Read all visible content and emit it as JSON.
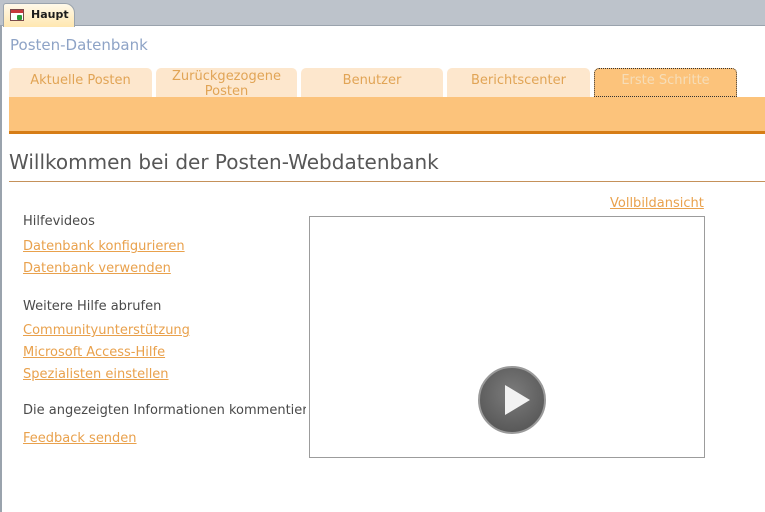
{
  "document_tab": {
    "label": "Haupt",
    "icon": "form-icon"
  },
  "database_title": "Posten-Datenbank",
  "nav_tabs": [
    {
      "label": "Aktuelle Posten"
    },
    {
      "label": "Zurückgezogene Posten"
    },
    {
      "label": "Benutzer"
    },
    {
      "label": "Berichtscenter"
    },
    {
      "label": "Erste Schritte",
      "active": true
    }
  ],
  "main": {
    "heading": "Willkommen bei der Posten-Webdatenbank",
    "fullscreen_link": "Vollbildansicht"
  },
  "help": {
    "videos_label": "Hilfevideos",
    "video_links": [
      "Datenbank konfigurieren",
      "Datenbank verwenden"
    ],
    "more_help_label": "Weitere Hilfe abrufen",
    "more_help_links": [
      "Communityunterstützung",
      "Microsoft Access-Hilfe",
      "Spezialisten einstellen"
    ],
    "feedback_label": "Die angezeigten Informationen kommentieren",
    "feedback_link": "Feedback senden"
  },
  "video_player": {
    "icon": "play-icon"
  },
  "colors": {
    "accent": "#e9a14c",
    "band": "#fcc37b",
    "band_line": "#d67d16",
    "tab_bg": "#fde7cd",
    "title_blue": "#8ea3c6"
  }
}
